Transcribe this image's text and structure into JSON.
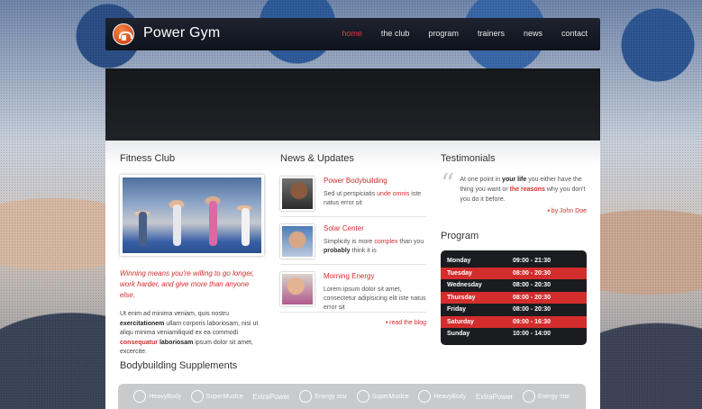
{
  "header": {
    "brand": "Power Gym",
    "nav": [
      "home",
      "the club",
      "program",
      "trainers",
      "news",
      "contact"
    ],
    "active_index": 0
  },
  "fitness": {
    "title": "Fitness Club",
    "quote": "Winning means you're willing to go longer, work harder, and give more than anyone else.",
    "para_1": "Ut enim ad minima veniam, quis nostru",
    "para_bold_1": "exercitationem",
    "para_2": " ullam corporis laboriosam, nisi ut aliqu minima veniamiliquid ex ea commodi ",
    "para_red": "consequatur",
    "para_bold_2": "laboriosam",
    "para_3": " ipsum dolor sit amet, excercite."
  },
  "news": {
    "title": "News & Updates",
    "items": [
      {
        "title": "Power Bodybuilding",
        "text_a": "Sed ut perspiciatis ",
        "text_red": "unde omnis",
        "text_b": " iste natus error sit"
      },
      {
        "title": "Solar Center",
        "text_a": "Simplicity is more ",
        "text_red": "complex",
        "text_b": " than you ",
        "text_bold": "probably",
        "text_c": " think it is"
      },
      {
        "title": "Morning Energy",
        "text_a": "Lorem ipsum dolor sit amet, consectetur adipisicing elit iste natus error sit"
      }
    ],
    "read_blog": "read the blog"
  },
  "testimonials": {
    "title": "Testimonials",
    "text_a": "At one point in ",
    "text_bold": "your life",
    "text_b": " you either have the thing you want or ",
    "text_red": "the reasons",
    "text_c": " why you don't you do it before.",
    "author": "by John Doe"
  },
  "program": {
    "title": "Program",
    "rows": [
      {
        "day": "Monday",
        "hours": "09:00 - 21:30",
        "highlight": false
      },
      {
        "day": "Tuesday",
        "hours": "08:00 - 20:30",
        "highlight": true
      },
      {
        "day": "Wednesday",
        "hours": "08:00 - 20:30",
        "highlight": false
      },
      {
        "day": "Thursday",
        "hours": "08:00 - 20:30",
        "highlight": true
      },
      {
        "day": "Friday",
        "hours": "08:00 - 20:30",
        "highlight": false
      },
      {
        "day": "Saturday",
        "hours": "09:00 - 16:30",
        "highlight": true
      },
      {
        "day": "Sunday",
        "hours": "10:00 - 14:00",
        "highlight": false
      }
    ]
  },
  "supplements": {
    "title": "Bodybuilding Supplements",
    "brands": [
      "HeavyBody",
      "SuperMuslce",
      "ExtraPower",
      "Energy star",
      "SuperMuslce",
      "HeavyBody",
      "ExtraPower",
      "Energy star"
    ]
  },
  "colors": {
    "accent": "#d32d2d",
    "header_bg": "#151922",
    "schedule_bg": "#1a1c20"
  }
}
